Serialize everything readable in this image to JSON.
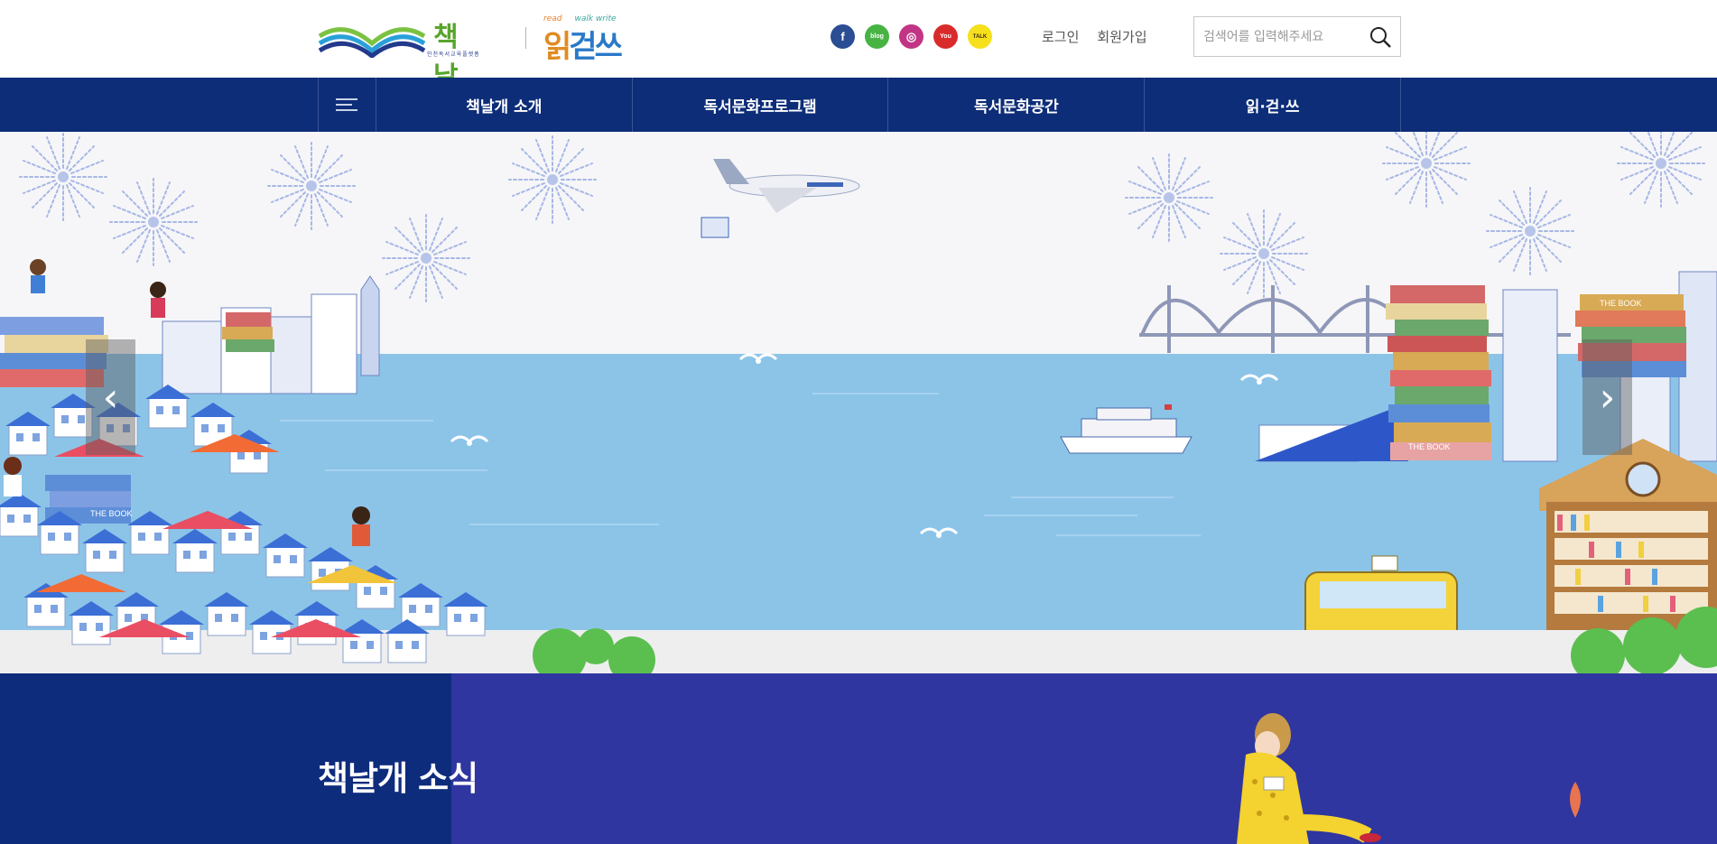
{
  "header": {
    "logo_main": "책날개",
    "logo_sub": "인천독서교육플랫폼",
    "logo2_read": "read",
    "logo2_walk": "walk write",
    "logo2_main_a": "읽",
    "logo2_main_b": "걷",
    "logo2_main_c": "쓰",
    "social": [
      {
        "icon": "facebook-icon",
        "glyph": "f"
      },
      {
        "icon": "blog-icon",
        "glyph": "blog"
      },
      {
        "icon": "instagram-icon",
        "glyph": "◎"
      },
      {
        "icon": "youtube-icon",
        "glyph": "You"
      },
      {
        "icon": "kakaotalk-icon",
        "glyph": "TALK"
      }
    ],
    "login_label": "로그인",
    "signup_label": "회원가입",
    "search_placeholder": "검색어를 입력해주세요"
  },
  "nav": {
    "menu_icon": "hamburger-menu-icon",
    "items": [
      "책날개 소개",
      "독서문화프로그램",
      "독서문화공간",
      "읽·걷·쓰"
    ]
  },
  "hero": {
    "prev_glyph": "‹",
    "next_glyph": "›",
    "book_label": "THE BOOK"
  },
  "news": {
    "title": "책날개 소식"
  },
  "colors": {
    "nav_bg": "#0d2d78",
    "news_bg": "#2f36a0",
    "news_band": "#0e2c7c",
    "sea": "#8cc4e8"
  }
}
